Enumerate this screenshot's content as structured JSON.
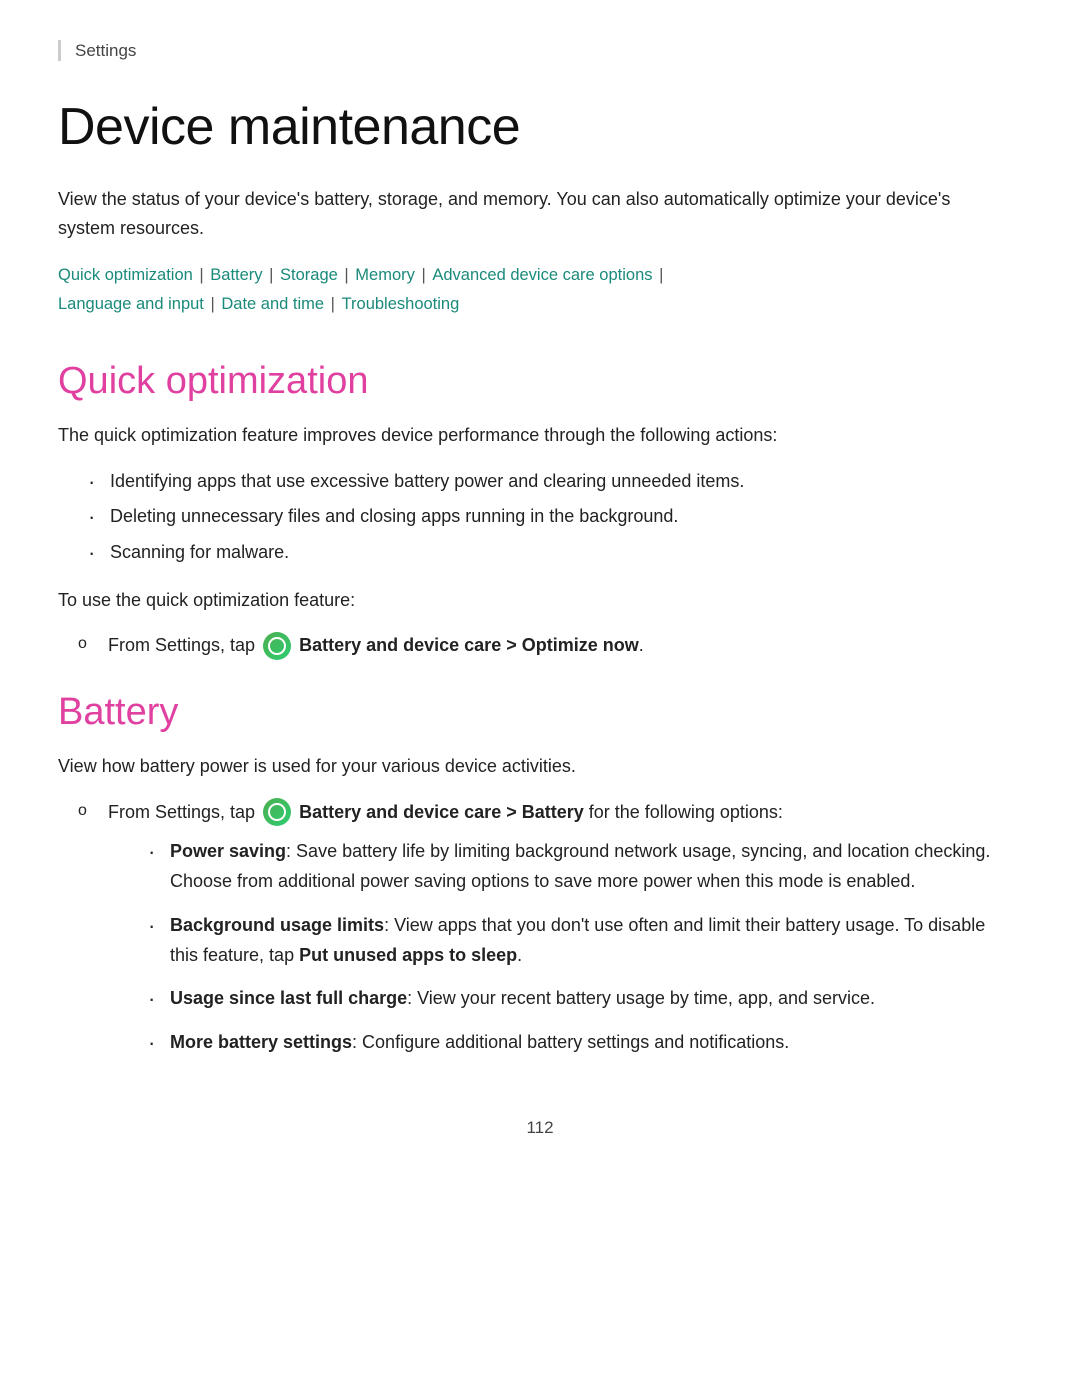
{
  "breadcrumb": {
    "label": "Settings"
  },
  "page": {
    "title": "Device maintenance",
    "intro": "View the status of your device's battery, storage, and memory. You can also automatically optimize your device's system resources.",
    "nav_links": [
      {
        "label": "Quick optimization",
        "id": "quick-opt"
      },
      {
        "label": "Battery",
        "id": "battery"
      },
      {
        "label": "Storage",
        "id": "storage"
      },
      {
        "label": "Memory",
        "id": "memory"
      },
      {
        "label": "Advanced device care options",
        "id": "advanced"
      },
      {
        "label": "Language and input",
        "id": "language"
      },
      {
        "label": "Date and time",
        "id": "date"
      },
      {
        "label": "Troubleshooting",
        "id": "trouble"
      }
    ]
  },
  "quick_optimization": {
    "title": "Quick optimization",
    "intro": "The quick optimization feature improves device performance through the following actions:",
    "bullets": [
      "Identifying apps that use excessive battery power and clearing unneeded items.",
      "Deleting unnecessary files and closing apps running in the background.",
      "Scanning for malware."
    ],
    "step_intro": "To use the quick optimization feature:",
    "step": "From Settings, tap",
    "step_bold": "Battery and device care > Optimize now",
    "step_end": "."
  },
  "battery": {
    "title": "Battery",
    "intro": "View how battery power is used for your various device activities.",
    "step_prefix": "From Settings, tap",
    "step_bold": "Battery and device care > Battery",
    "step_suffix": "for the following options:",
    "options": [
      {
        "label": "Power saving",
        "text": ": Save battery life by limiting background network usage, syncing, and location checking. Choose from additional power saving options to save more power when this mode is enabled."
      },
      {
        "label": "Background usage limits",
        "text": ": View apps that you don't use often and limit their battery usage. To disable this feature, tap",
        "bold2": "Put unused apps to sleep",
        "text2": "."
      },
      {
        "label": "Usage since last full charge",
        "text": ": View your recent battery usage by time, app, and service."
      },
      {
        "label": "More battery settings",
        "text": ": Configure additional battery settings and notifications."
      }
    ]
  },
  "page_number": "112"
}
